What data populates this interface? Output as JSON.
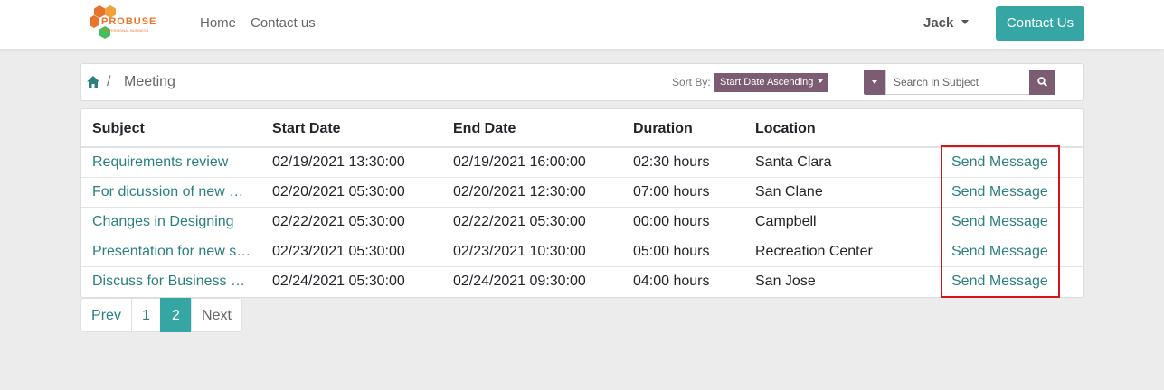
{
  "navbar": {
    "logo_text": "PROBUSE",
    "logo_sub": "PROFESSIONAL BUSINESS",
    "links": [
      "Home",
      "Contact us"
    ],
    "user": "Jack",
    "cta": "Contact Us"
  },
  "breadcrumb": {
    "separator": "/",
    "current": "Meeting"
  },
  "sort": {
    "label": "Sort By:",
    "value": "Start Date Ascending"
  },
  "search": {
    "placeholder": "Search in Subject"
  },
  "table": {
    "headers": [
      "Subject",
      "Start Date",
      "End Date",
      "Duration",
      "Location",
      ""
    ],
    "rows": [
      {
        "subject": "Requirements review",
        "start": "02/19/2021 13:30:00",
        "end": "02/19/2021 16:00:00",
        "duration": "02:30 hours",
        "location": "Santa Clara",
        "action": "Send Message"
      },
      {
        "subject": "For dicussion of new Project",
        "start": "02/20/2021 05:30:00",
        "end": "02/20/2021 12:30:00",
        "duration": "07:00 hours",
        "location": "San Clane",
        "action": "Send Message"
      },
      {
        "subject": "Changes in Designing",
        "start": "02/22/2021 05:30:00",
        "end": "02/22/2021 05:30:00",
        "duration": "00:00 hours",
        "location": "Campbell",
        "action": "Send Message"
      },
      {
        "subject": "Presentation for new sales",
        "start": "02/23/2021 05:30:00",
        "end": "02/23/2021 10:30:00",
        "duration": "05:00 hours",
        "location": "Recreation Center",
        "action": "Send Message"
      },
      {
        "subject": "Discuss for Business Growth",
        "start": "02/24/2021 05:30:00",
        "end": "02/24/2021 09:30:00",
        "duration": "04:00 hours",
        "location": "San Jose",
        "action": "Send Message"
      }
    ]
  },
  "pagination": {
    "prev": "Prev",
    "pages": [
      "1",
      "2"
    ],
    "active": "2",
    "next": "Next"
  },
  "colors": {
    "accent": "#35a6a3",
    "link": "#2b7f7f",
    "purple": "#7b5c72",
    "highlight": "#d7141a"
  }
}
